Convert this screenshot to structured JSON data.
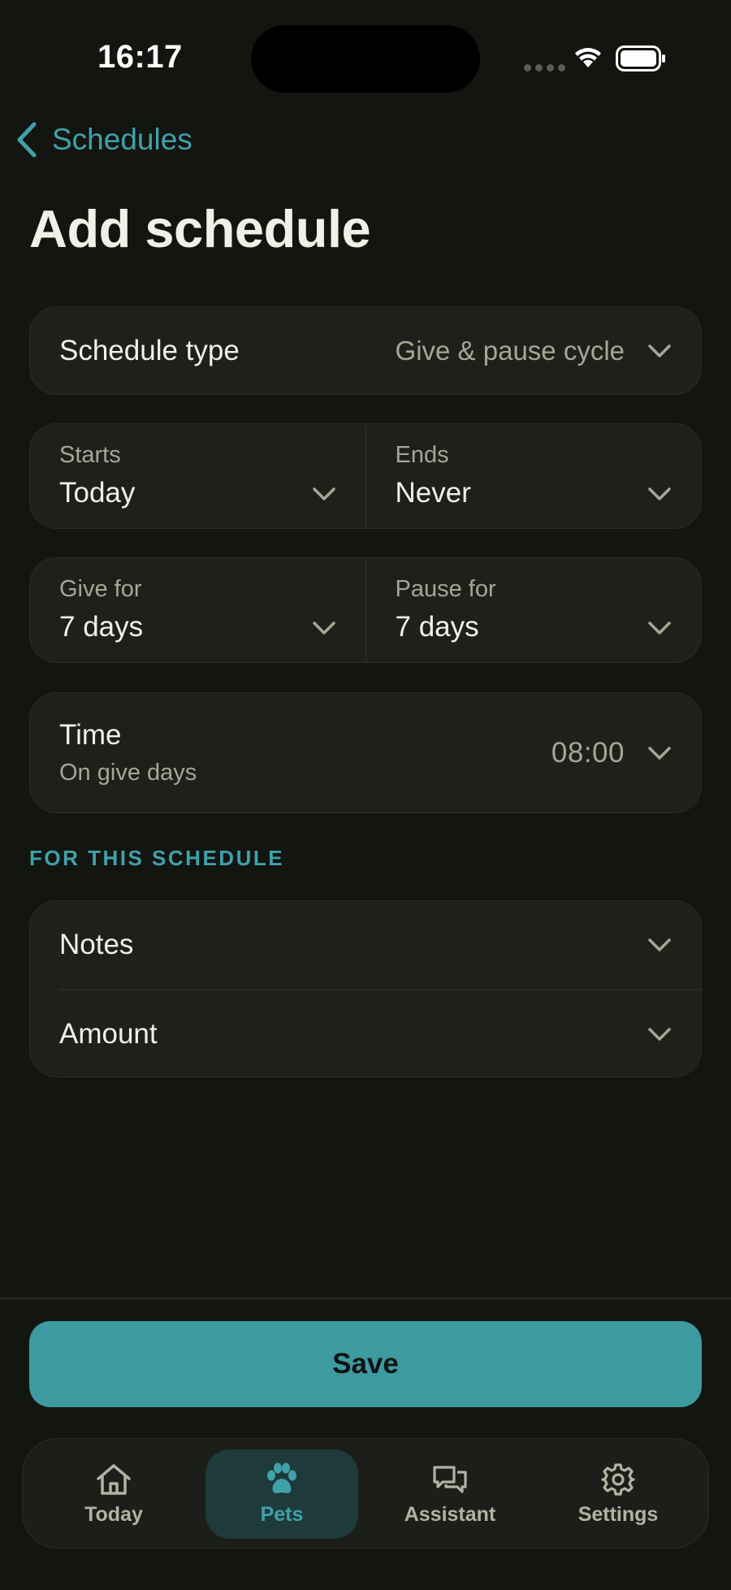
{
  "status_bar": {
    "time": "16:17"
  },
  "nav": {
    "back_label": "Schedules",
    "title": "Add schedule"
  },
  "schedule_type": {
    "label": "Schedule type",
    "value": "Give & pause cycle"
  },
  "dates": {
    "starts_label": "Starts",
    "starts_value": "Today",
    "ends_label": "Ends",
    "ends_value": "Never"
  },
  "cycle": {
    "give_label": "Give for",
    "give_value": "7 days",
    "pause_label": "Pause for",
    "pause_value": "7 days"
  },
  "time": {
    "label": "Time",
    "sublabel": "On give days",
    "value": "08:00"
  },
  "section": {
    "header": "FOR THIS SCHEDULE"
  },
  "extras": {
    "notes_label": "Notes",
    "amount_label": "Amount"
  },
  "save_label": "Save",
  "tabs": [
    {
      "label": "Today",
      "icon": "house-icon"
    },
    {
      "label": "Pets",
      "icon": "paw-icon",
      "active": true
    },
    {
      "label": "Assistant",
      "icon": "chat-bubbles-icon"
    },
    {
      "label": "Settings",
      "icon": "gear-icon"
    }
  ],
  "colors": {
    "accent": "#3fa1a9",
    "background": "#131511",
    "card": "#1e201c"
  }
}
